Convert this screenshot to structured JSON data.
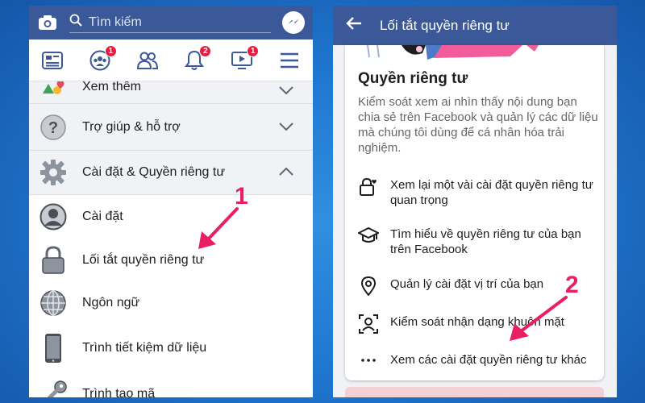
{
  "left": {
    "search": {
      "placeholder": "Tìm kiếm"
    },
    "nav": [
      {
        "icon": "news-feed-icon"
      },
      {
        "icon": "groups-icon",
        "badge": "1"
      },
      {
        "icon": "friends-icon"
      },
      {
        "icon": "notifications-icon",
        "badge": "2"
      },
      {
        "icon": "watch-icon",
        "badge": "1"
      },
      {
        "icon": "menu-icon"
      }
    ],
    "menu": {
      "see_more": "Xem thêm",
      "help": "Trợ giúp & hỗ trợ",
      "settings_privacy": "Cài đặt & Quyền riêng tư",
      "settings": "Cài đặt",
      "privacy_shortcuts": "Lối tắt quyền riêng tư",
      "language": "Ngôn ngữ",
      "data_saver": "Trình tiết kiệm dữ liệu",
      "code_generator": "Trình tạo mã"
    }
  },
  "right": {
    "title": "Lối tắt quyền riêng tư",
    "card": {
      "heading": "Quyền riêng tư",
      "description": "Kiểm soát xem ai nhìn thấy nội dung bạn chia sẻ trên Facebook và quản lý các dữ liệu mà chúng tôi dùng để cá nhân hóa trải nghiệm.",
      "options": [
        {
          "icon": "lock-heart-icon",
          "text": "Xem lại một vài cài đặt quyền riêng tư quan trọng"
        },
        {
          "icon": "graduation-cap-icon",
          "text": "Tìm hiểu về quyền riêng tư của bạn trên Facebook"
        },
        {
          "icon": "location-pin-icon",
          "text": "Quản lý cài đặt vị trí của bạn"
        },
        {
          "icon": "face-recognition-icon",
          "text": "Kiểm soát nhận dạng khuôn mặt"
        },
        {
          "icon": "more-dots-icon",
          "text": "Xem các cài đặt quyền riêng tư khác"
        }
      ]
    }
  },
  "annotations": {
    "step1": "1",
    "step2": "2"
  },
  "colors": {
    "facebook_blue": "#3b5998",
    "badge_red": "#e41e3f",
    "annotation_pink": "#e91e63"
  }
}
